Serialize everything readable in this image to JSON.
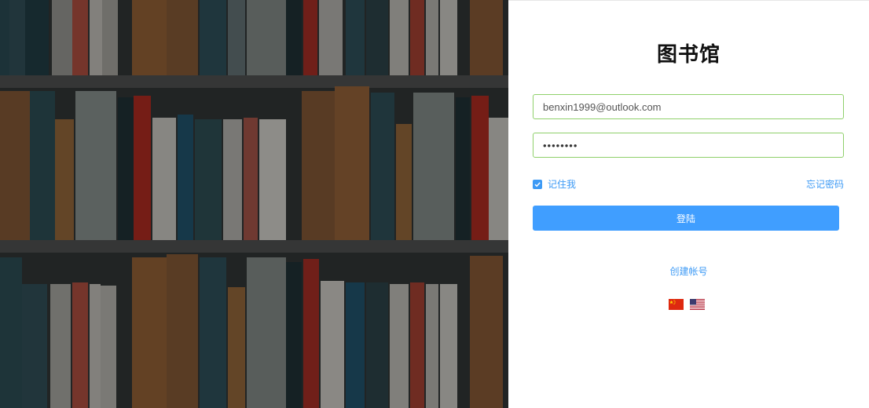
{
  "app": {
    "title": "图书馆"
  },
  "login": {
    "email_value": "benxin1999@outlook.com",
    "password_value": "••••••••",
    "remember_label": "记住我",
    "remember_checked": true,
    "forgot_label": "忘记密码",
    "submit_label": "登陆",
    "create_account_label": "创建帐号"
  },
  "language": {
    "options": [
      {
        "icon": "china-flag-icon"
      },
      {
        "icon": "usa-flag-icon"
      }
    ]
  },
  "colors": {
    "accent": "#409eff",
    "input_border": "#8fd06b",
    "shelf_bg": "#3a3c3c"
  }
}
